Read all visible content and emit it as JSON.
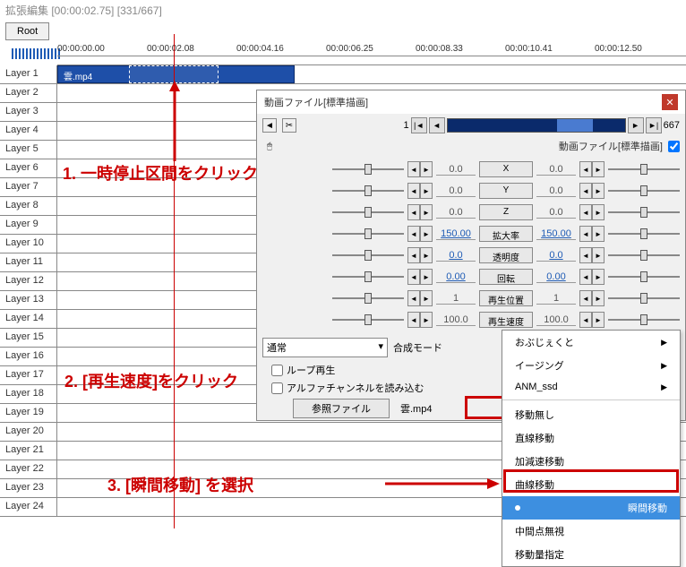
{
  "window_title": "拡張編集 [00:00:02.75] [331/667]",
  "root_button": "Root",
  "time_ticks": [
    "00:00:00.00",
    "00:00:02.08",
    "00:00:04.16",
    "00:00:06.25",
    "00:00:08.33",
    "00:00:10.41",
    "00:00:12.50"
  ],
  "layers": [
    "Layer 1",
    "Layer 2",
    "Layer 3",
    "Layer 4",
    "Layer 5",
    "Layer 6",
    "Layer 7",
    "Layer 8",
    "Layer 9",
    "Layer 10",
    "Layer 11",
    "Layer 12",
    "Layer 13",
    "Layer 14",
    "Layer 15",
    "Layer 16",
    "Layer 17",
    "Layer 18",
    "Layer 19",
    "Layer 20",
    "Layer 21",
    "Layer 22",
    "Layer 23",
    "Layer 24"
  ],
  "clip_name": "雲.mp4",
  "annotations": {
    "a1": "1.  一時停止区間をクリック",
    "a2": "2. [再生速度]をクリック",
    "a3": "3. [瞬間移動] を選択"
  },
  "dialog": {
    "title": "動画ファイル[標準描画]",
    "frame_current": "1",
    "frame_total": "667",
    "sub_label": "動画ファイル[標準描画]",
    "params": [
      {
        "label": "X",
        "v1": "0.0",
        "v2": "0.0"
      },
      {
        "label": "Y",
        "v1": "0.0",
        "v2": "0.0"
      },
      {
        "label": "Z",
        "v1": "0.0",
        "v2": "0.0"
      },
      {
        "label": "拡大率",
        "v1": "150.00",
        "v2": "150.00"
      },
      {
        "label": "透明度",
        "v1": "0.0",
        "v2": "0.0"
      },
      {
        "label": "回転",
        "v1": "0.00",
        "v2": "0.00"
      },
      {
        "label": "再生位置",
        "v1": "1",
        "v2": "1"
      },
      {
        "label": "再生速度",
        "v1": "100.0",
        "v2": "100.0"
      }
    ],
    "mode_value": "通常",
    "mode_label": "合成モード",
    "loop_label": "ループ再生",
    "alpha_label": "アルファチャンネルを読み込む",
    "ref_label": "参照ファイル",
    "ref_value": "雲.mp4"
  },
  "menu": {
    "top": [
      "おぶじぇくと",
      "イージング",
      "ANM_ssd"
    ],
    "bottom": [
      "移動無し",
      "直線移動",
      "加減速移動",
      "曲線移動",
      "瞬間移動",
      "中間点無視",
      "移動量指定"
    ]
  }
}
